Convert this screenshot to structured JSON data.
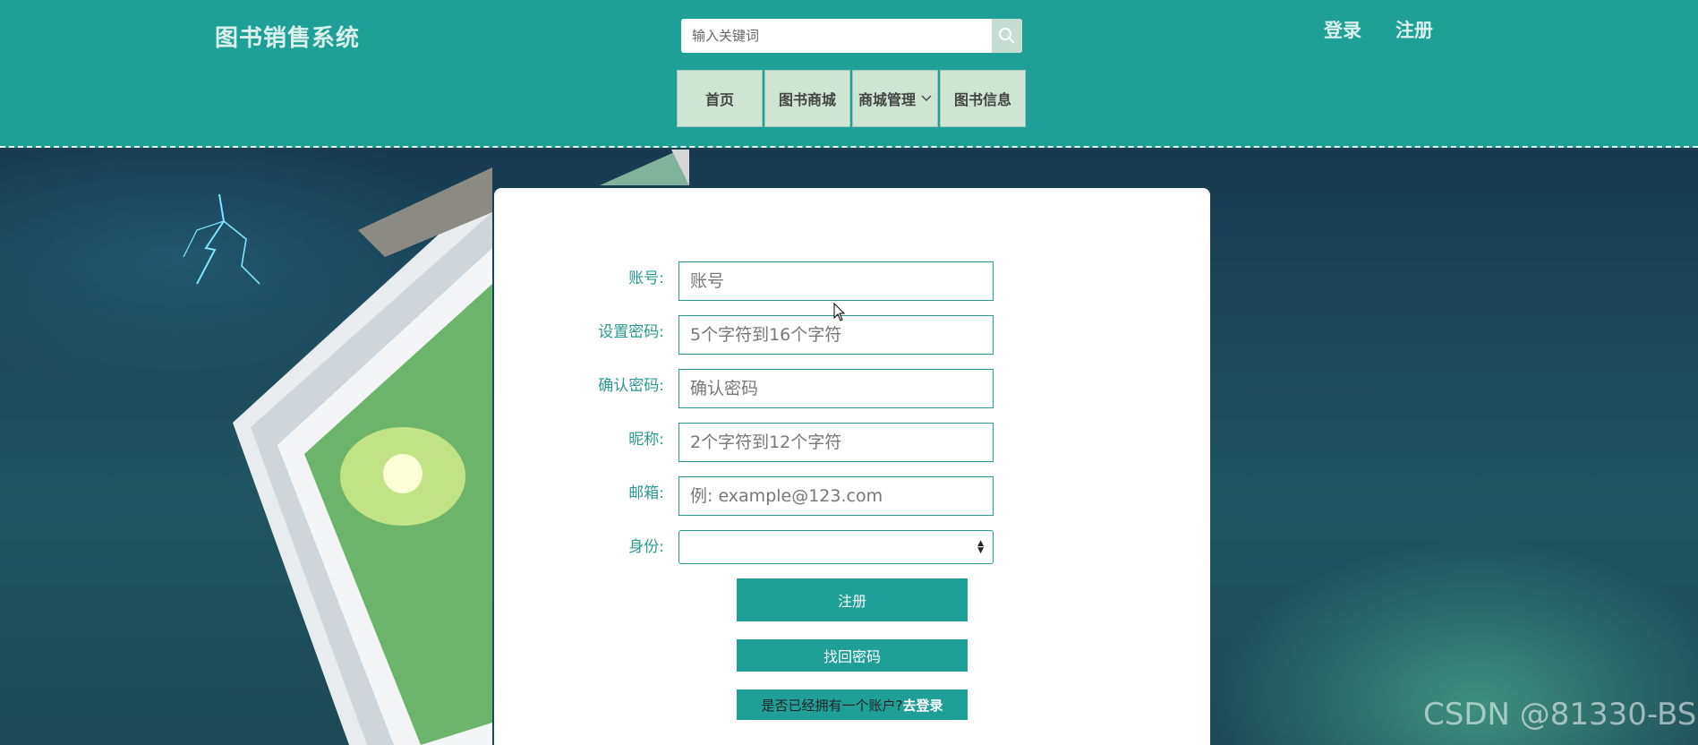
{
  "header": {
    "brand": "图书销售系统",
    "search": {
      "placeholder": "输入关键词"
    },
    "auth": {
      "login": "登录",
      "register": "注册"
    },
    "nav": [
      {
        "label": "首页"
      },
      {
        "label": "图书商城"
      },
      {
        "label": "商城管理"
      },
      {
        "label": "图书信息"
      }
    ]
  },
  "form": {
    "fields": [
      {
        "label": "账号:",
        "placeholder": "账号"
      },
      {
        "label": "设置密码:",
        "placeholder": "5个字符到16个字符"
      },
      {
        "label": "确认密码:",
        "placeholder": "确认密码"
      },
      {
        "label": "昵称:",
        "placeholder": "2个字符到12个字符"
      },
      {
        "label": "邮箱:",
        "placeholder": "例: example@123.com"
      },
      {
        "label": "身份:",
        "value": ""
      }
    ],
    "buttons": {
      "register": "注册",
      "recover": "找回密码",
      "has_account": "是否已经拥有一个账户?",
      "go_login": "去登录"
    }
  },
  "watermark": "CSDN @81330-BS",
  "colors": {
    "header": "#1fa096",
    "accent": "#2a9a90",
    "nav_bg": "#cfe5d3",
    "card": "#ffffff"
  },
  "icons": {
    "search": "search-icon",
    "nav_dropdown": "chevron-down-icon",
    "select": "select-arrows-icon"
  }
}
